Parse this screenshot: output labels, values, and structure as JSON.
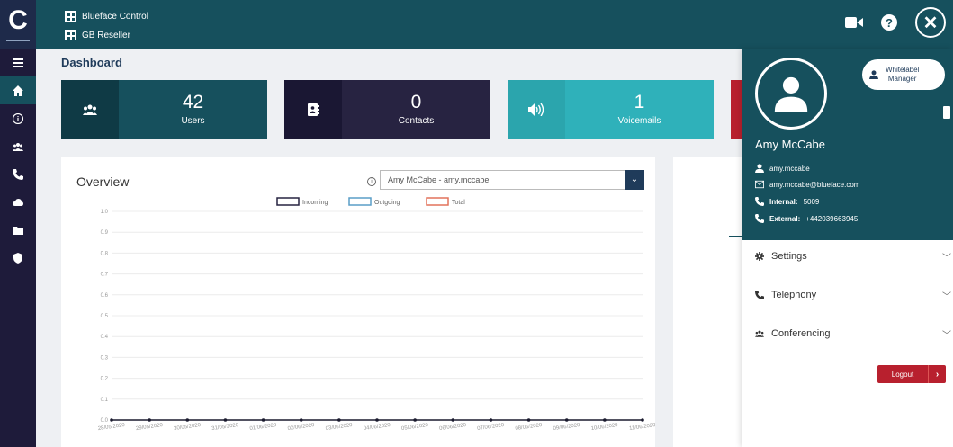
{
  "header": {
    "app_name": "Blueface Control",
    "account": "GB Reseller",
    "icons": [
      "video-icon",
      "help-icon",
      "close-icon"
    ]
  },
  "sidebar": {
    "items": [
      {
        "icon": "menu-icon"
      },
      {
        "icon": "home-icon",
        "active": true
      },
      {
        "icon": "info-icon"
      },
      {
        "icon": "users-icon"
      },
      {
        "icon": "phone-icon"
      },
      {
        "icon": "cloud-icon"
      },
      {
        "icon": "folder-icon"
      },
      {
        "icon": "shield-icon"
      }
    ]
  },
  "dashboard": {
    "title": "Dashboard",
    "stats": [
      {
        "value": "42",
        "label": "Users"
      },
      {
        "value": "0",
        "label": "Contacts"
      },
      {
        "value": "1",
        "label": "Voicemails"
      }
    ]
  },
  "overview": {
    "title": "Overview",
    "selected_user": "Amy McCabe - amy.mccabe"
  },
  "chart_data": {
    "type": "line",
    "legend": [
      "Incoming",
      "Outgoing",
      "Total"
    ],
    "legend_colors": [
      "#272341",
      "#5a9ec7",
      "#e2725b"
    ],
    "legend_placement": "top",
    "x": [
      "28/05/2020",
      "29/05/2020",
      "30/05/2020",
      "31/05/2020",
      "01/06/2020",
      "02/06/2020",
      "03/06/2020",
      "04/06/2020",
      "05/06/2020",
      "06/06/2020",
      "07/06/2020",
      "08/06/2020",
      "09/06/2020",
      "10/06/2020",
      "11/06/2020"
    ],
    "yticks": [
      "0.0",
      "0.1",
      "0.2",
      "0.3",
      "0.4",
      "0.5",
      "0.6",
      "0.7",
      "0.8",
      "0.9",
      "1.0"
    ],
    "ylim": [
      0,
      1
    ],
    "series": [
      {
        "name": "Incoming",
        "values": [
          0,
          0,
          0,
          0,
          0,
          0,
          0,
          0,
          0,
          0,
          0,
          0,
          0,
          0,
          0
        ]
      },
      {
        "name": "Outgoing",
        "values": [
          0,
          0,
          0,
          0,
          0,
          0,
          0,
          0,
          0,
          0,
          0,
          0,
          0,
          0,
          0
        ]
      },
      {
        "name": "Total",
        "values": [
          0,
          0,
          0,
          0,
          0,
          0,
          0,
          0,
          0,
          0,
          0,
          0,
          0,
          0,
          0
        ]
      }
    ],
    "grid": true
  },
  "profile": {
    "name": "Amy McCabe",
    "username": "amy.mccabe",
    "email": "amy.mccabe@blueface.com",
    "internal_label": "Internal:",
    "internal_value": "5009",
    "external_label": "External:",
    "external_value": "+442039663945",
    "role_line1": "Whitelabel",
    "role_line2": "Manager"
  },
  "panel_menu": {
    "settings": "Settings",
    "telephony": "Telephony",
    "conferencing": "Conferencing",
    "logout": "Logout"
  },
  "colors": {
    "teal_dark": "#16505d",
    "navy": "#1e1b3a",
    "cyan": "#2fb1ba",
    "red": "#b8202e"
  }
}
